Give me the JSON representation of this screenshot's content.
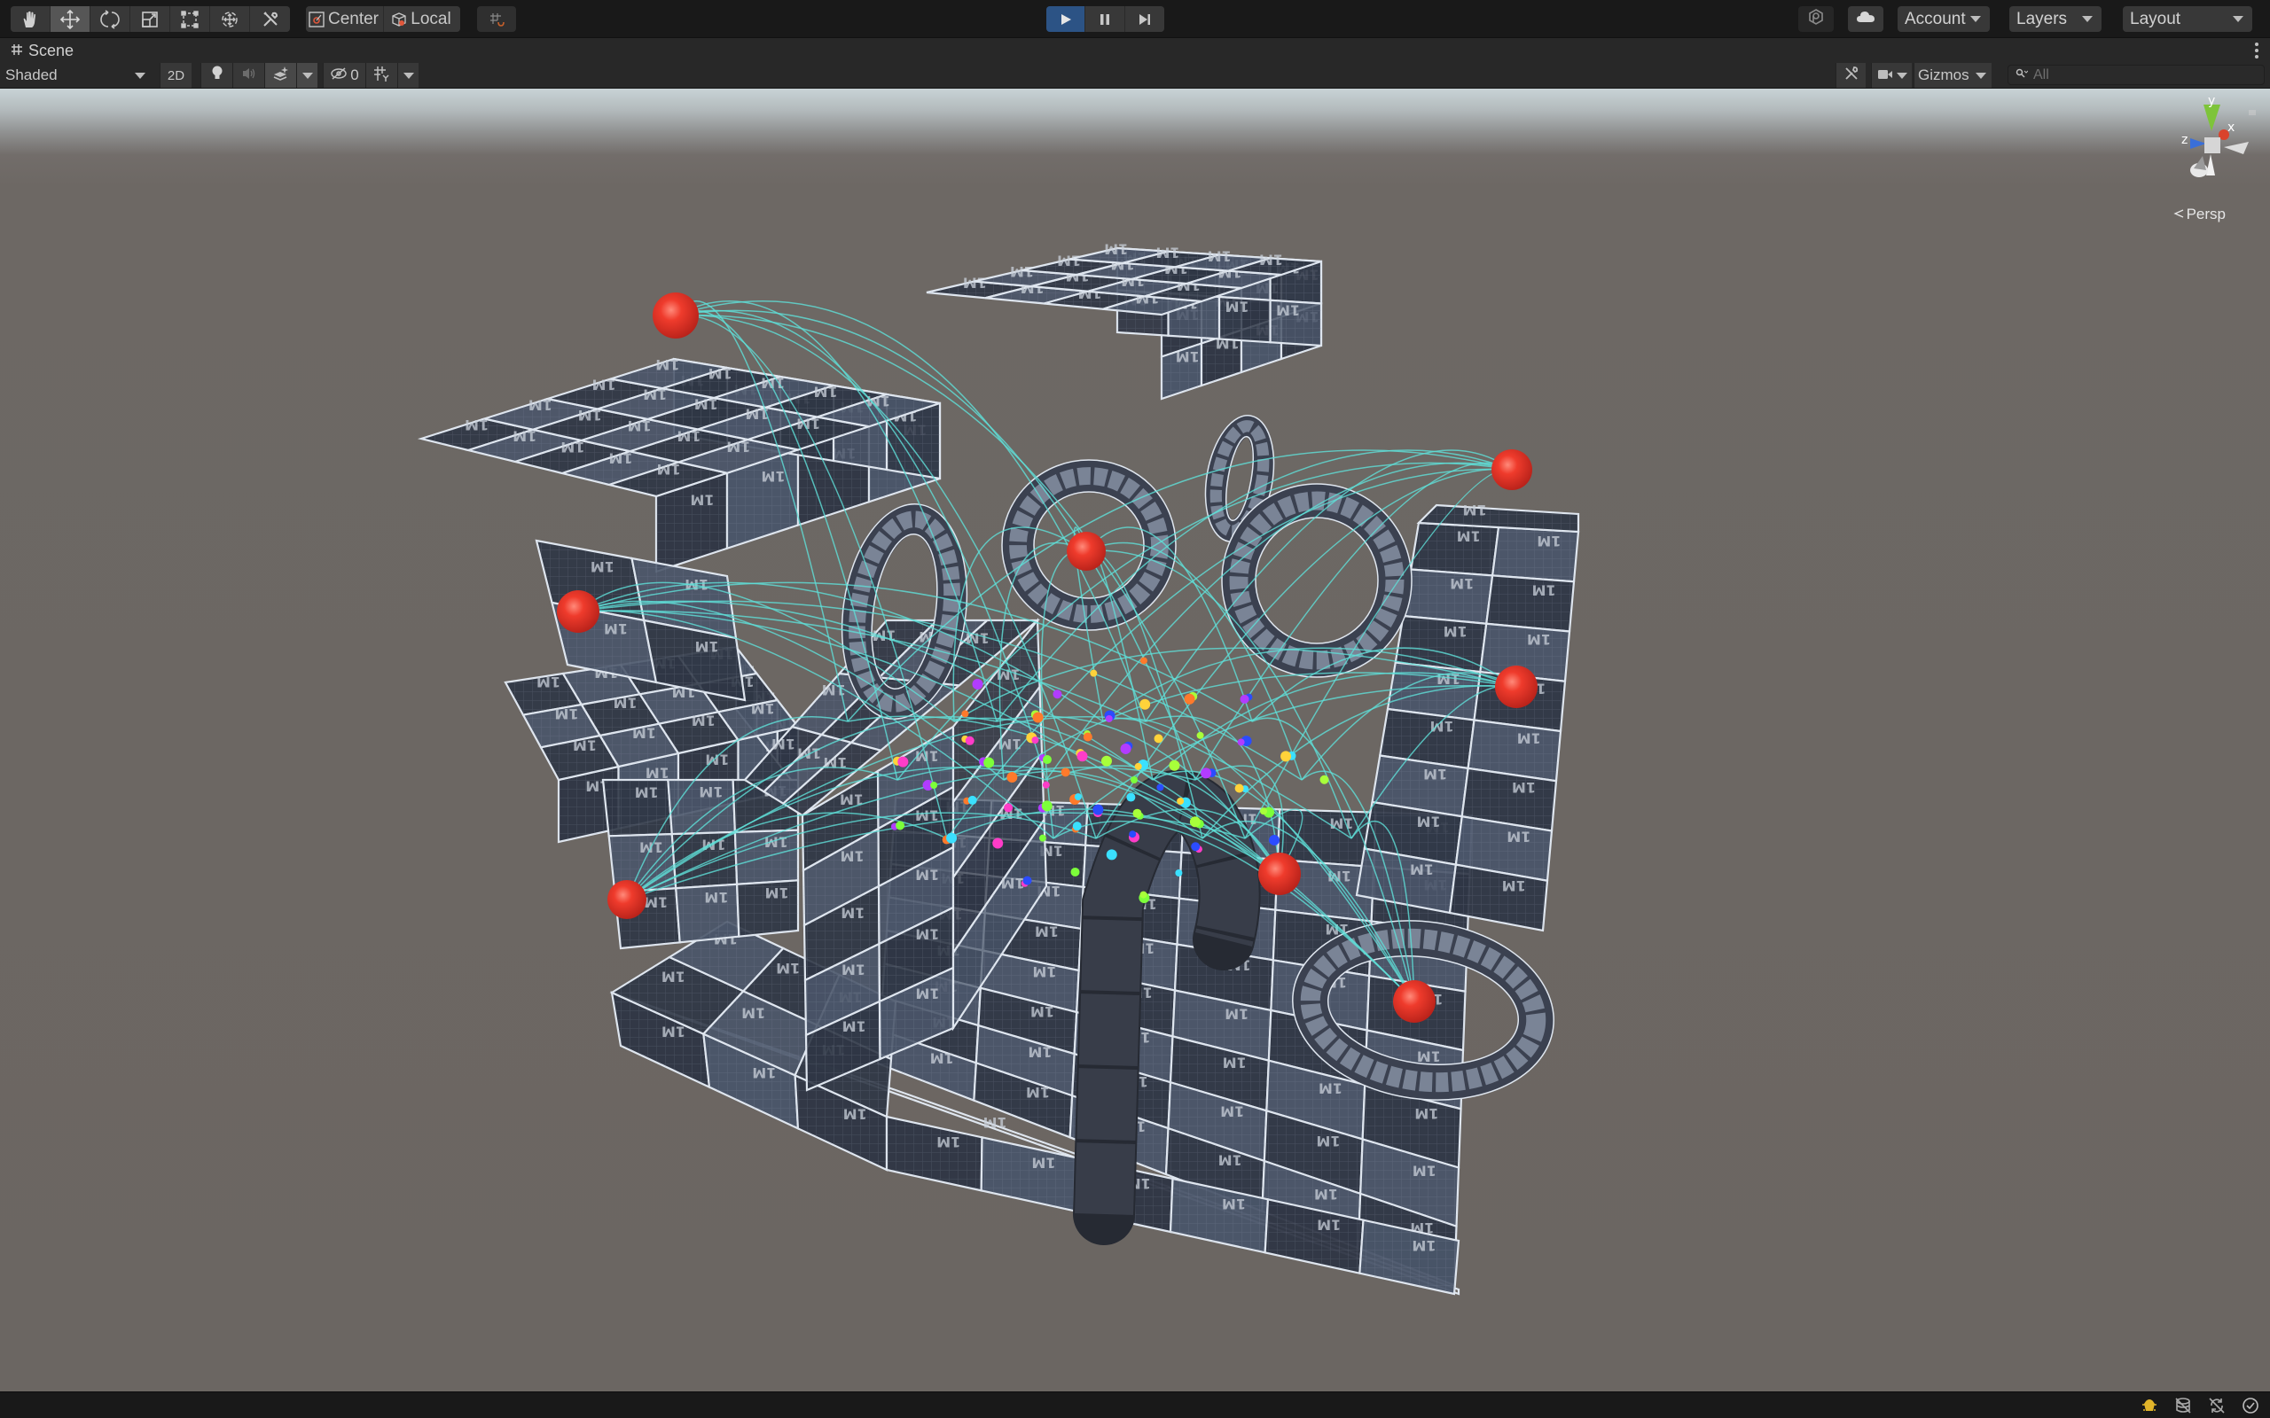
{
  "toolbar": {
    "tools": [
      {
        "name": "hand-tool",
        "icon": "hand-icon",
        "active": false
      },
      {
        "name": "move-tool",
        "icon": "move-icon",
        "active": true
      },
      {
        "name": "rotate-tool",
        "icon": "rotate-icon",
        "active": false
      },
      {
        "name": "scale-tool",
        "icon": "scale-icon",
        "active": false
      },
      {
        "name": "rect-tool",
        "icon": "rect-transform-icon",
        "active": false
      },
      {
        "name": "transform-tool",
        "icon": "transform-icon",
        "active": false
      },
      {
        "name": "custom-tool",
        "icon": "custom-tools-icon",
        "active": false
      }
    ],
    "pivot_mode": "Center",
    "pivot_rotation": "Local",
    "snap_icon": "grid-snap-icon",
    "playback": {
      "play_icon": "play-icon",
      "pause_icon": "pause-icon",
      "step_icon": "step-icon",
      "playing": true
    },
    "services_icon": "unity-services-icon",
    "cloud_icon": "cloud-icon",
    "account": "Account",
    "layers": "Layers",
    "layout": "Layout"
  },
  "scene_tab": {
    "icon": "scene-grid-icon",
    "label": "Scene",
    "menu_icon": "kebab-menu-icon"
  },
  "scene_toolbar": {
    "draw_mode": "Shaded",
    "mode_2d": "2D",
    "lighting_icon": "lightbulb-icon",
    "audio_icon": "audio-icon",
    "effects_icon": "scene-effects-icon",
    "hidden_icon": "hidden-objects-icon",
    "hidden_count": "0",
    "grid_icon": "grid-icon",
    "tools_icon": "tools-icon",
    "camera_icon": "camera-icon",
    "gizmos": "Gizmos",
    "search_placeholder": "All"
  },
  "viewport": {
    "projection": "Persp",
    "axes": {
      "x": "x",
      "y": "y",
      "z": "z"
    },
    "tile_label": "1M",
    "colors": {
      "sky": "#c8d3d6",
      "ground": "#6b6662",
      "tile_dark": "#2f3645",
      "tile_light": "#4a5569",
      "edge": "#dfe6ef",
      "sphere": "#ef3b2c",
      "trail": "#5fe0d8",
      "axis_x": "#d9432c",
      "axis_y": "#7ec43a",
      "axis_z": "#3a6fd9"
    }
  },
  "status_bar": {
    "icons": [
      "bug-icon",
      "cache-server-icon",
      "auto-generate-lighting-icon",
      "check-circle-icon"
    ]
  }
}
